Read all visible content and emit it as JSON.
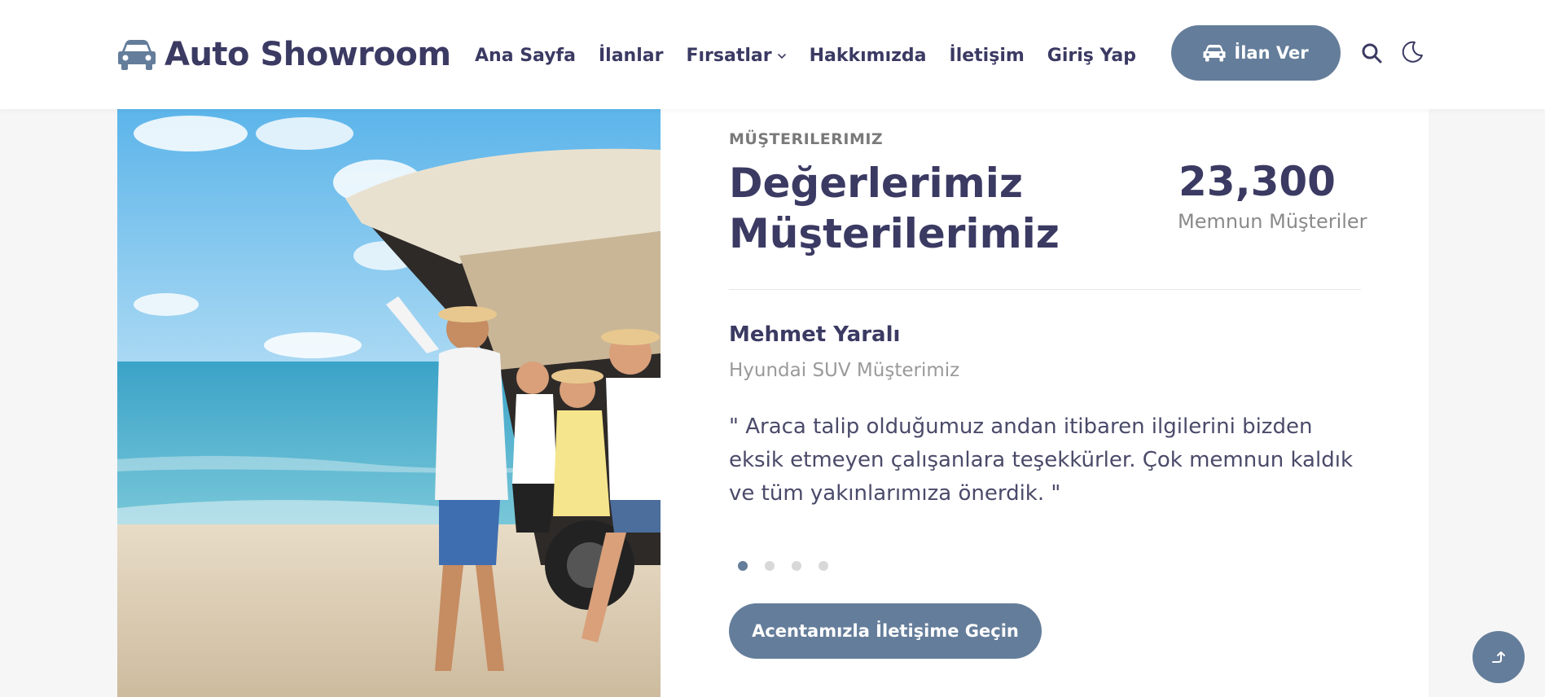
{
  "header": {
    "logo_text": "Auto Showroom",
    "logo_icon": "car-icon",
    "nav": [
      {
        "label": "Ana Sayfa"
      },
      {
        "label": "İlanlar"
      },
      {
        "label": "Fırsatlar",
        "has_dropdown": true
      },
      {
        "label": "Hakkımızda"
      },
      {
        "label": "İletişim"
      },
      {
        "label": "Giriş Yap"
      }
    ],
    "post_button_label": "İlan Ver",
    "search_icon": "search-icon",
    "theme_icon": "moon-icon"
  },
  "testimonial": {
    "eyebrow": "MÜŞTERILERIMIZ",
    "headline": "Değerlerimiz Müşterilerimiz",
    "stat_value": "23,300",
    "stat_label": "Memnun Müşteriler",
    "name": "Mehmet Yaralı",
    "subtitle": "Hyundai SUV Müşterimiz",
    "quote": "\" Araca talip olduğumuz andan itibaren ilgilerini bizden eksik etmeyen çalışanlara teşekkürler. Çok memnun kaldık ve tüm yakınlarımıza önerdik. \"",
    "slides_total": 4,
    "slide_active": 1,
    "cta_label": "Acentamızla İletişime Geçin"
  },
  "colors": {
    "primary": "#647d9a",
    "heading": "#3b3a63",
    "muted": "#8a8a8a",
    "background": "#f6f6f6"
  }
}
